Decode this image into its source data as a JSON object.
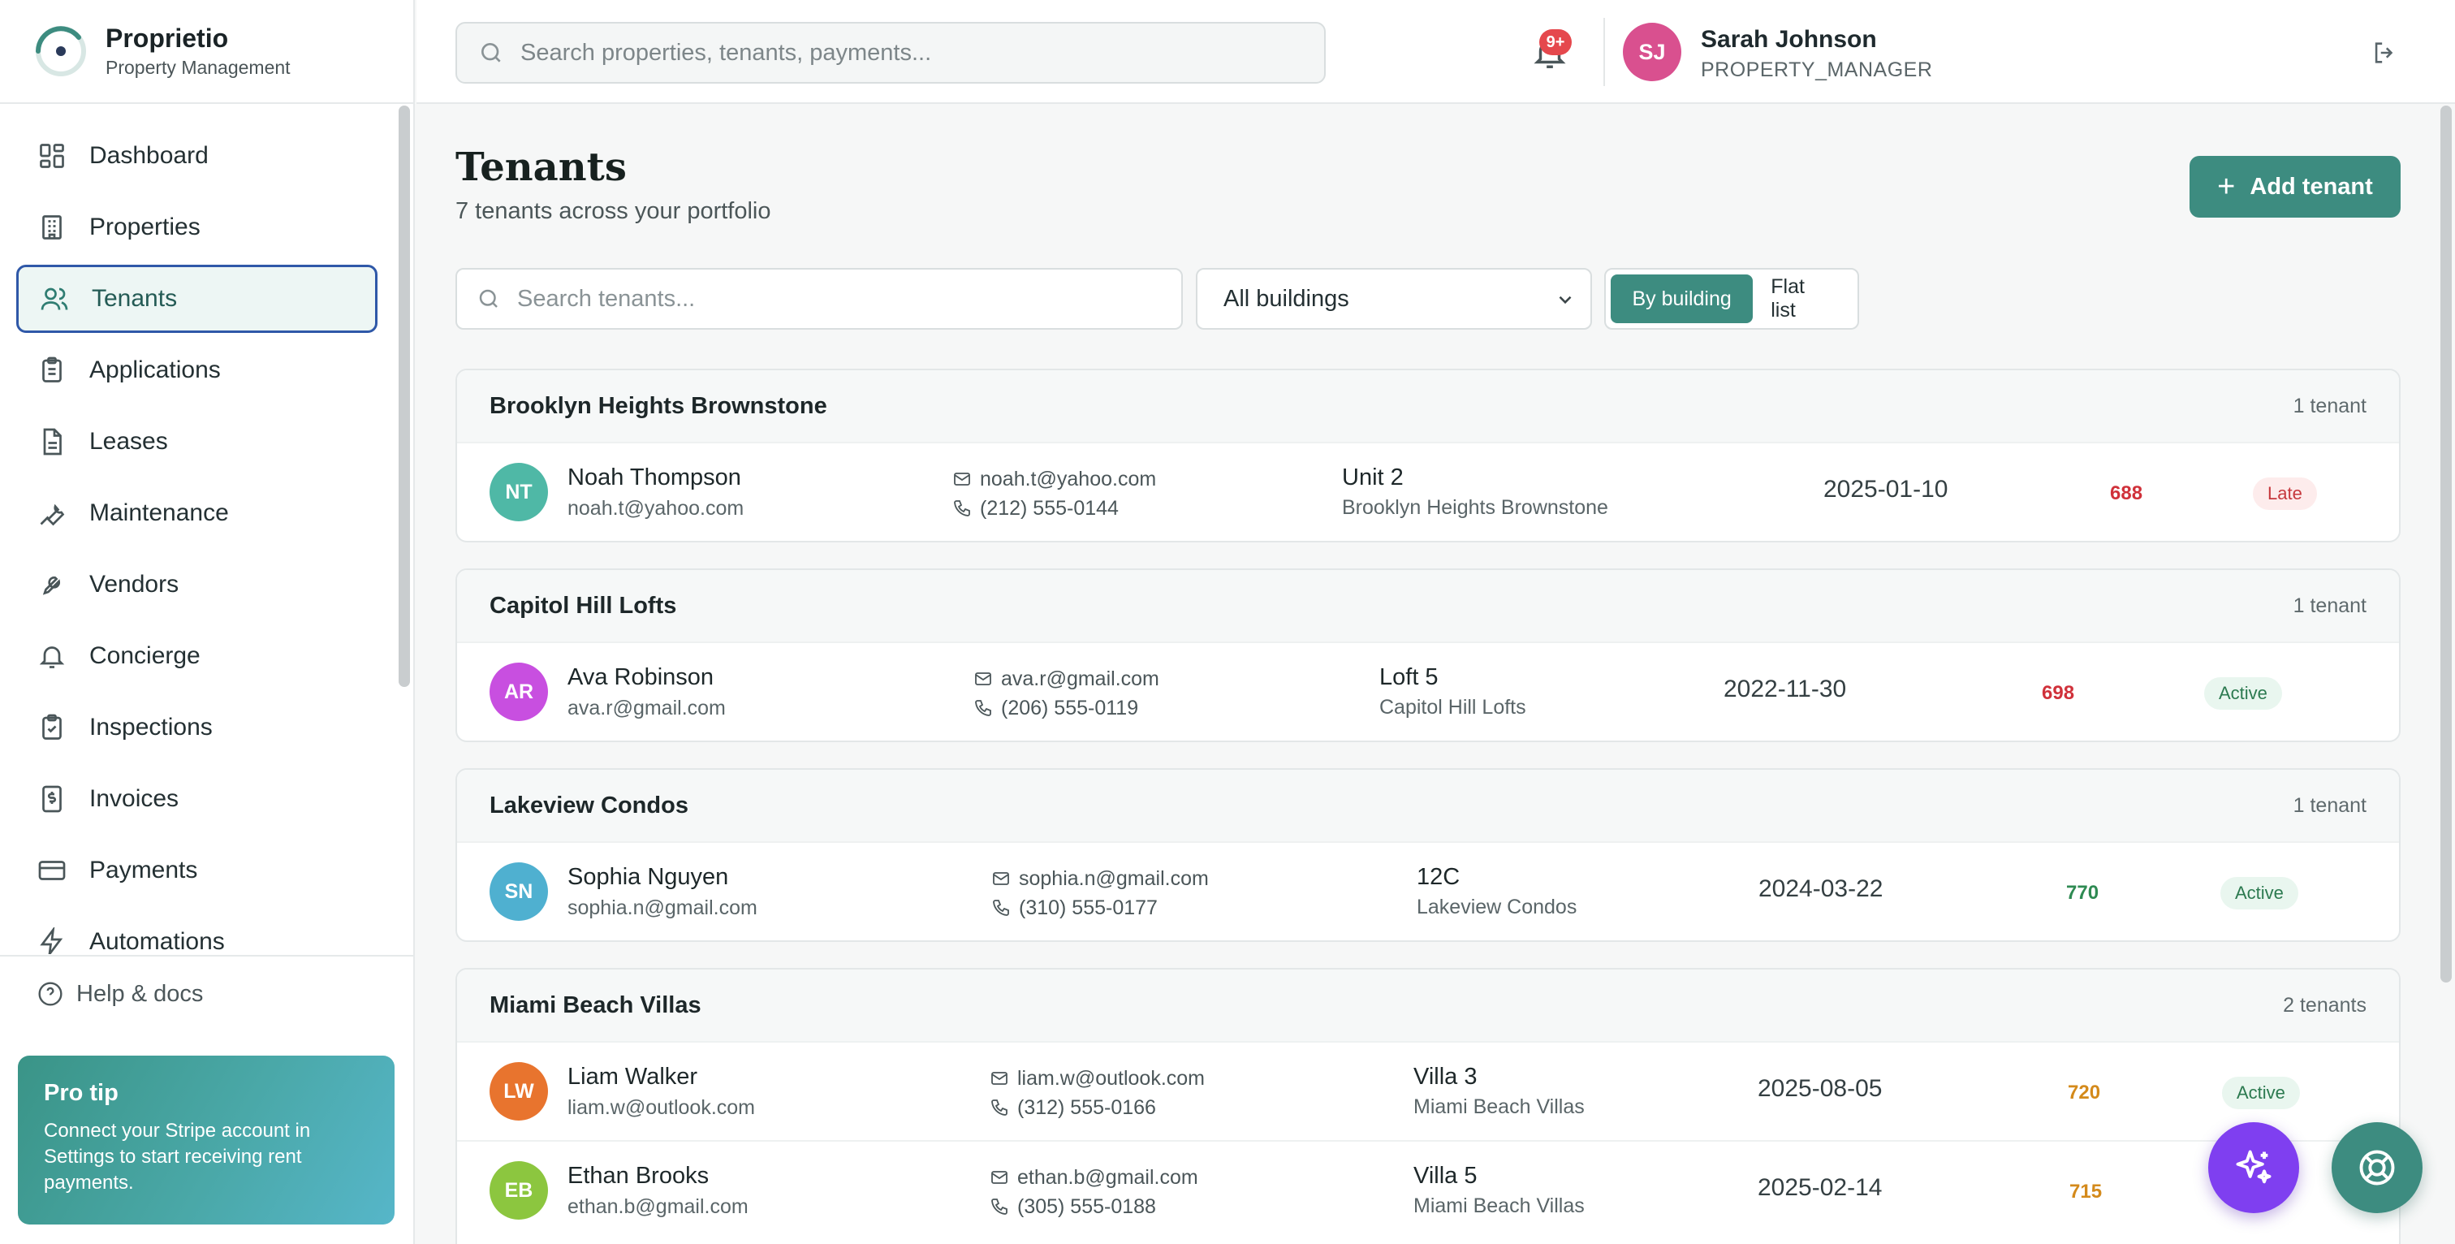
{
  "brand": {
    "name": "Proprietio",
    "subtitle": "Property Management"
  },
  "sidebar": {
    "items": [
      {
        "label": "Dashboard",
        "icon": "dashboard-icon"
      },
      {
        "label": "Properties",
        "icon": "building-icon"
      },
      {
        "label": "Tenants",
        "icon": "users-icon",
        "active": true
      },
      {
        "label": "Applications",
        "icon": "clipboard-icon"
      },
      {
        "label": "Leases",
        "icon": "document-icon"
      },
      {
        "label": "Maintenance",
        "icon": "wrench-icon"
      },
      {
        "label": "Vendors",
        "icon": "wrench-icon"
      },
      {
        "label": "Concierge",
        "icon": "bell-icon"
      },
      {
        "label": "Inspections",
        "icon": "clipboard-check-icon"
      },
      {
        "label": "Invoices",
        "icon": "invoice-icon"
      },
      {
        "label": "Payments",
        "icon": "credit-card-icon"
      },
      {
        "label": "Automations",
        "icon": "lightning-icon"
      }
    ],
    "help_label": "Help & docs",
    "protip": {
      "title": "Pro tip",
      "text": "Connect your Stripe account in Settings to start receiving rent payments."
    }
  },
  "topbar": {
    "search_placeholder": "Search properties, tenants, payments...",
    "notification_badge": "9+",
    "user": {
      "initials": "SJ",
      "name": "Sarah Johnson",
      "role": "PROPERTY_MANAGER"
    }
  },
  "page": {
    "title": "Tenants",
    "subtitle": "7 tenants across your portfolio",
    "add_button": "Add tenant",
    "search_placeholder": "Search tenants...",
    "building_filter": "All buildings",
    "view_toggle": [
      "By building",
      "Flat list"
    ]
  },
  "groups": [
    {
      "name": "Brooklyn Heights Brownstone",
      "count": "1 tenant",
      "tenants": [
        {
          "initials": "NT",
          "name": "Noah Thompson",
          "email": "noah.t@yahoo.com",
          "phone": "(212) 555-0144",
          "unit": "Unit 2",
          "building": "Brooklyn Heights Brownstone",
          "date": "2025-01-10",
          "score": "688",
          "status": "Late"
        }
      ]
    },
    {
      "name": "Capitol Hill Lofts",
      "count": "1 tenant",
      "tenants": [
        {
          "initials": "AR",
          "name": "Ava Robinson",
          "email": "ava.r@gmail.com",
          "phone": "(206) 555-0119",
          "unit": "Loft 5",
          "building": "Capitol Hill Lofts",
          "date": "2022-11-30",
          "score": "698",
          "status": "Active"
        }
      ]
    },
    {
      "name": "Lakeview Condos",
      "count": "1 tenant",
      "tenants": [
        {
          "initials": "SN",
          "name": "Sophia Nguyen",
          "email": "sophia.n@gmail.com",
          "phone": "(310) 555-0177",
          "unit": "12C",
          "building": "Lakeview Condos",
          "date": "2024-03-22",
          "score": "770",
          "status": "Active"
        }
      ]
    },
    {
      "name": "Miami Beach Villas",
      "count": "2 tenants",
      "tenants": [
        {
          "initials": "LW",
          "name": "Liam Walker",
          "email": "liam.w@outlook.com",
          "phone": "(312) 555-0166",
          "unit": "Villa 3",
          "building": "Miami Beach Villas",
          "date": "2025-08-05",
          "score": "720",
          "status": "Active"
        },
        {
          "initials": "EB",
          "name": "Ethan Brooks",
          "email": "ethan.b@gmail.com",
          "phone": "(305) 555-0188",
          "unit": "Villa 5",
          "building": "Miami Beach Villas",
          "date": "2025-02-14",
          "score": "715",
          "status": ""
        }
      ]
    }
  ],
  "colors": {
    "accent": "#3d8c80",
    "active_nav_border": "#2f58a8",
    "late": "#c6383d",
    "active": "#2c7a50",
    "score_red": "#d0313a",
    "score_green": "#2e8a52",
    "score_amber": "#d48a1b",
    "avatar_nt": "#4fb8a6",
    "avatar_ar": "#c84fe0",
    "avatar_sn": "#4fb0d0",
    "avatar_lw": "#e8742e",
    "avatar_eb": "#8cc63f"
  }
}
